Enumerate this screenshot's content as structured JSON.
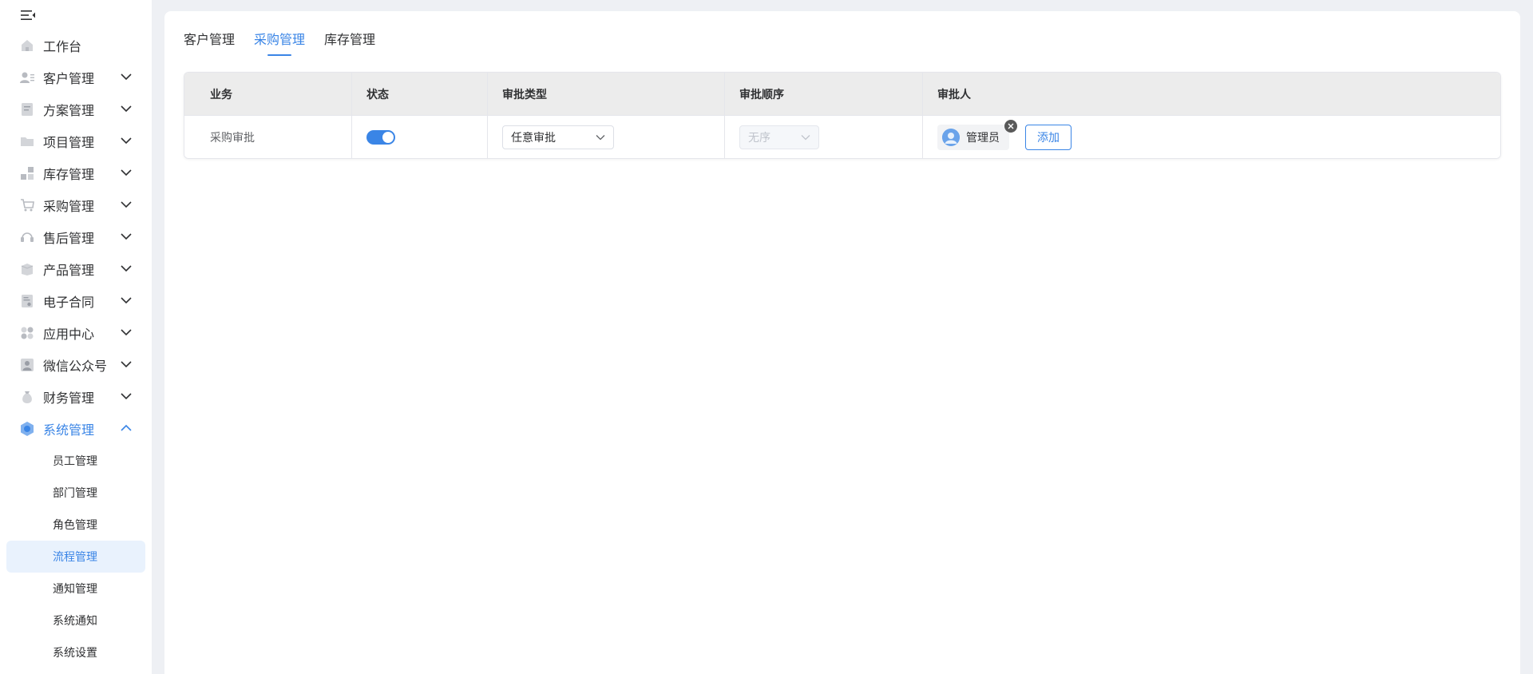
{
  "sidebar": {
    "collapse_icon": "menu-fold-icon",
    "items": [
      {
        "label": "工作台",
        "icon": "home-icon",
        "expandable": false
      },
      {
        "label": "客户管理",
        "icon": "customer-icon",
        "expandable": true
      },
      {
        "label": "方案管理",
        "icon": "document-icon",
        "expandable": true
      },
      {
        "label": "项目管理",
        "icon": "folder-icon",
        "expandable": true
      },
      {
        "label": "库存管理",
        "icon": "inventory-icon",
        "expandable": true
      },
      {
        "label": "采购管理",
        "icon": "cart-icon",
        "expandable": true
      },
      {
        "label": "售后管理",
        "icon": "headset-icon",
        "expandable": true
      },
      {
        "label": "产品管理",
        "icon": "box-icon",
        "expandable": true
      },
      {
        "label": "电子合同",
        "icon": "contract-icon",
        "expandable": true
      },
      {
        "label": "应用中心",
        "icon": "apps-icon",
        "expandable": true
      },
      {
        "label": "微信公众号",
        "icon": "wechat-account-icon",
        "expandable": true
      },
      {
        "label": "财务管理",
        "icon": "money-bag-icon",
        "expandable": true
      },
      {
        "label": "系统管理",
        "icon": "system-icon",
        "expandable": true,
        "expanded": true,
        "active": true
      }
    ],
    "submenu": [
      {
        "label": "员工管理"
      },
      {
        "label": "部门管理"
      },
      {
        "label": "角色管理"
      },
      {
        "label": "流程管理",
        "active": true
      },
      {
        "label": "通知管理"
      },
      {
        "label": "系统通知"
      },
      {
        "label": "系统设置"
      }
    ]
  },
  "main": {
    "tabs": [
      {
        "label": "客户管理",
        "active": false
      },
      {
        "label": "采购管理",
        "active": true
      },
      {
        "label": "库存管理",
        "active": false
      }
    ],
    "table": {
      "headers": [
        "业务",
        "状态",
        "审批类型",
        "审批顺序",
        "审批人"
      ],
      "rows": [
        {
          "business": "采购审批",
          "status_enabled": true,
          "approval_type": "任意审批",
          "approval_order": "无序",
          "approvers": [
            "管理员"
          ],
          "add_label": "添加"
        }
      ]
    }
  },
  "colors": {
    "accent": "#3a85e6",
    "active_bg": "#e9f2fd",
    "header_bg": "#ececec",
    "page_bg": "#eef0f4"
  }
}
